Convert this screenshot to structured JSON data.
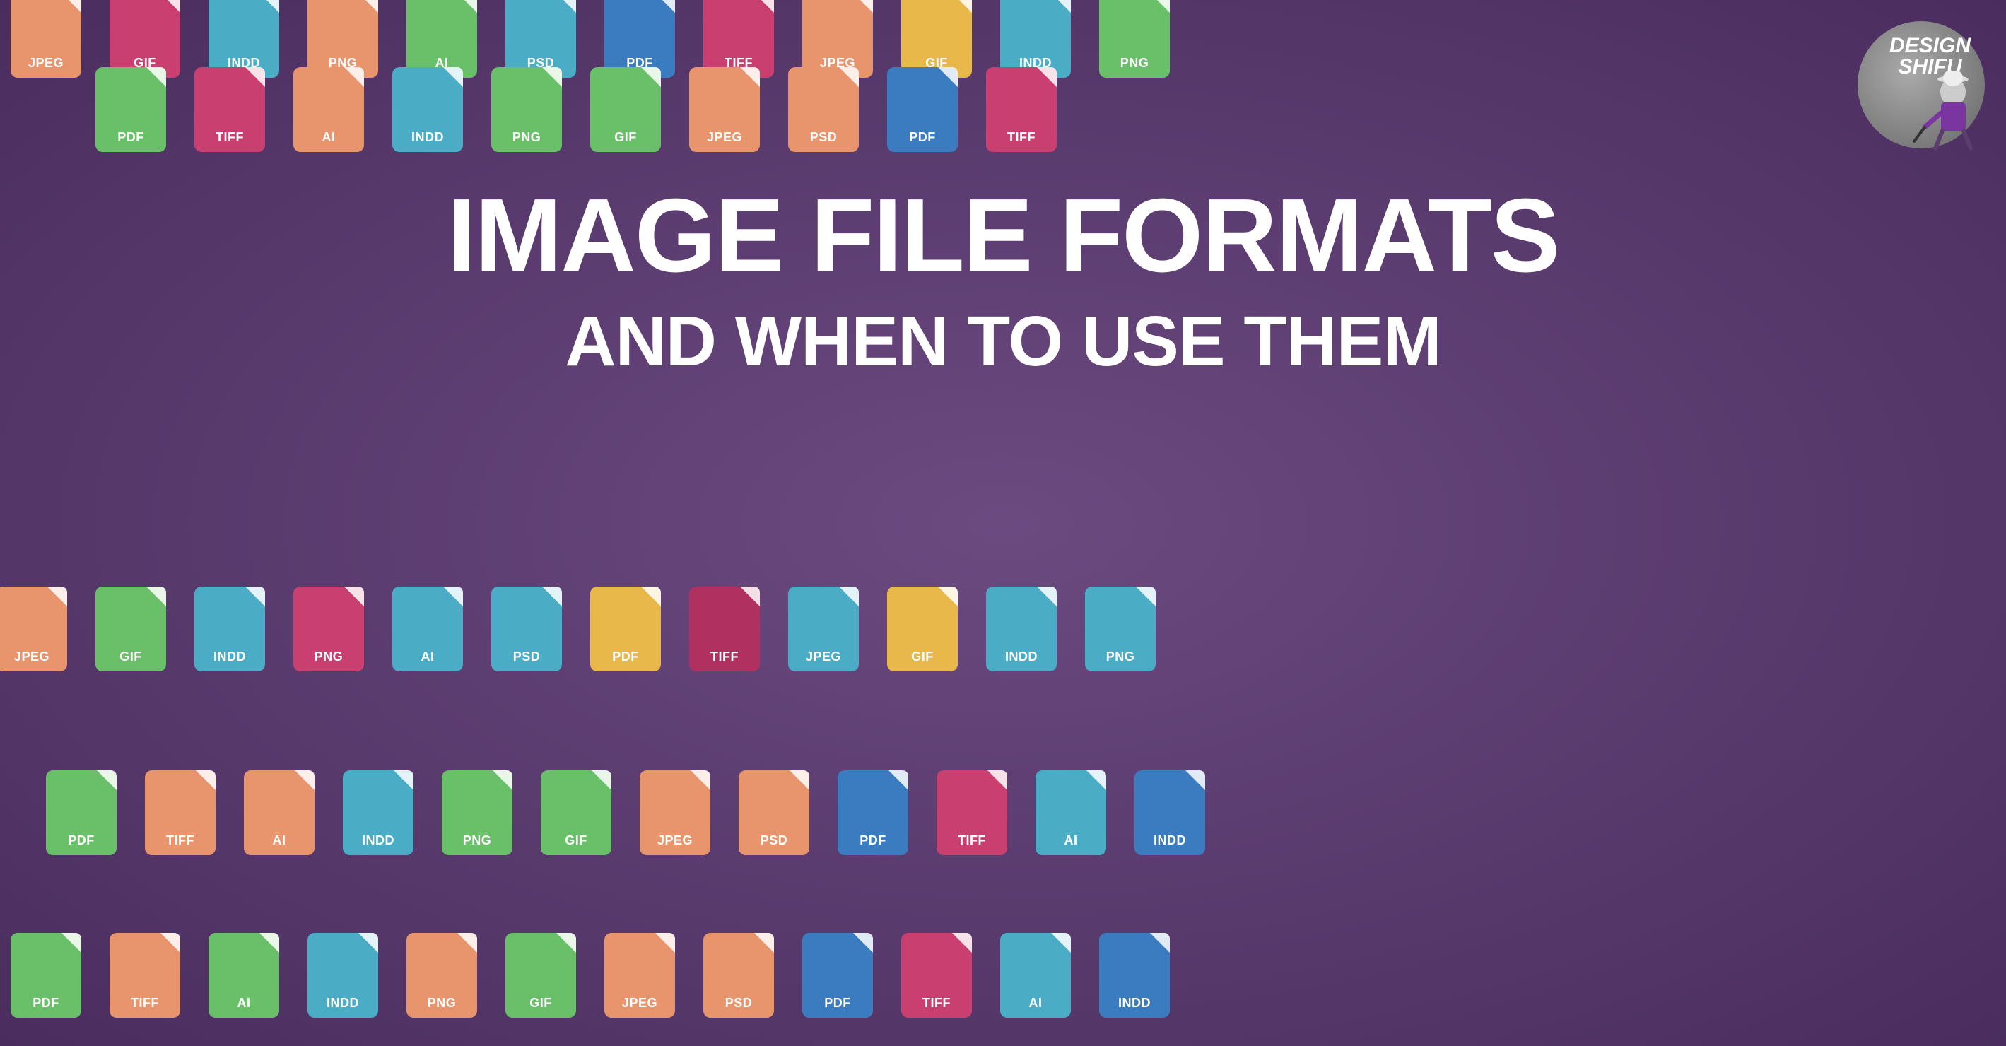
{
  "page": {
    "bg_color": "#5c3d6e",
    "title_line1": "IMAGE FILE FORMATS",
    "title_line2": "AND WHEN TO USE THEM"
  },
  "logo": {
    "line1": "DESIGN",
    "line2": "SHIFU"
  },
  "file_formats": [
    "JPEG",
    "GIF",
    "INDD",
    "PNG",
    "AI",
    "PSD",
    "PDF",
    "TIFF",
    "JPEG",
    "GIF",
    "INDD",
    "PNG"
  ],
  "rows": {
    "row1": [
      {
        "label": "JPEG",
        "color": "orange"
      },
      {
        "label": "GIF",
        "color": "pink"
      },
      {
        "label": "INDD",
        "color": "teal"
      },
      {
        "label": "PNG",
        "color": "orange"
      },
      {
        "label": "AI",
        "color": "green"
      },
      {
        "label": "PSD",
        "color": "teal"
      },
      {
        "label": "PDF",
        "color": "blue"
      },
      {
        "label": "TIFF",
        "color": "pink"
      },
      {
        "label": "JPEG",
        "color": "orange"
      },
      {
        "label": "GIF",
        "color": "yellow"
      }
    ],
    "row2": [
      {
        "label": "PDF",
        "color": "green"
      },
      {
        "label": "TIFF",
        "color": "pink"
      },
      {
        "label": "AI",
        "color": "orange"
      },
      {
        "label": "INDD",
        "color": "teal"
      },
      {
        "label": "PNG",
        "color": "green"
      },
      {
        "label": "GIF",
        "color": "green"
      },
      {
        "label": "JPEG",
        "color": "orange"
      },
      {
        "label": "PSD",
        "color": "orange"
      },
      {
        "label": "PDF",
        "color": "blue"
      },
      {
        "label": "TIFF",
        "color": "pink"
      }
    ],
    "row3": [
      {
        "label": "JPEG",
        "color": "orange"
      },
      {
        "label": "GIF",
        "color": "green"
      },
      {
        "label": "INDD",
        "color": "teal"
      },
      {
        "label": "PNG",
        "color": "pink"
      },
      {
        "label": "AI",
        "color": "teal"
      },
      {
        "label": "PSD",
        "color": "teal"
      },
      {
        "label": "PDF",
        "color": "yellow"
      },
      {
        "label": "TIFF",
        "color": "pink"
      },
      {
        "label": "JPEG",
        "color": "teal"
      },
      {
        "label": "GIF",
        "color": "yellow"
      },
      {
        "label": "INDD",
        "color": "teal"
      },
      {
        "label": "PNG",
        "color": "teal"
      }
    ],
    "row4": [
      {
        "label": "PDF",
        "color": "green"
      },
      {
        "label": "TIFF",
        "color": "orange"
      },
      {
        "label": "AI",
        "color": "orange"
      },
      {
        "label": "INDD",
        "color": "teal"
      },
      {
        "label": "PNG",
        "color": "green"
      },
      {
        "label": "GIF",
        "color": "green"
      },
      {
        "label": "JPEG",
        "color": "orange"
      },
      {
        "label": "PSD",
        "color": "orange"
      },
      {
        "label": "PDF",
        "color": "blue"
      },
      {
        "label": "TIFF",
        "color": "pink"
      },
      {
        "label": "AI",
        "color": "teal"
      },
      {
        "label": "INDD",
        "color": "blue"
      }
    ],
    "row5": [
      {
        "label": "PDF",
        "color": "green"
      },
      {
        "label": "TIFF",
        "color": "orange"
      },
      {
        "label": "AI",
        "color": "green"
      },
      {
        "label": "INDD",
        "color": "teal"
      },
      {
        "label": "PNG",
        "color": "orange"
      },
      {
        "label": "GIF",
        "color": "green"
      },
      {
        "label": "JPEG",
        "color": "orange"
      },
      {
        "label": "PSD",
        "color": "orange"
      },
      {
        "label": "PDF",
        "color": "blue"
      },
      {
        "label": "TIFF",
        "color": "pink"
      },
      {
        "label": "AI",
        "color": "teal"
      },
      {
        "label": "INDD",
        "color": "blue"
      }
    ]
  }
}
